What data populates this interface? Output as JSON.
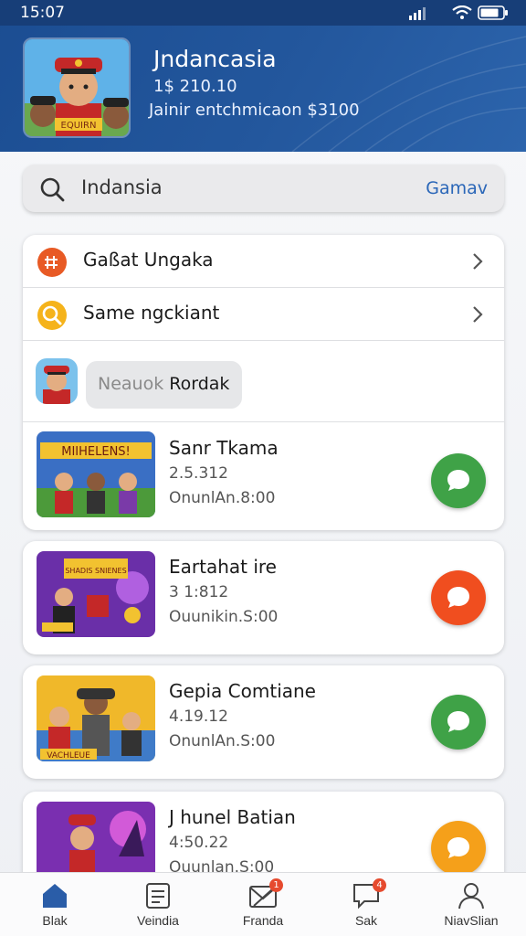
{
  "status_bar": {
    "time": "15:07"
  },
  "header": {
    "title": "Jndancasia",
    "subtitle_line1": "1$ 210.10",
    "subtitle_line2": "Jainir entchmicaon $3100"
  },
  "search": {
    "value": "Indansia",
    "action_label": "Gamav"
  },
  "menu": {
    "items": [
      {
        "label": "Gaßat Ungaka",
        "icon": "gift-icon",
        "color": "#e85a25"
      },
      {
        "label": "Same ngckiant",
        "icon": "search-icon",
        "color": "#f5b31b"
      }
    ],
    "chip": {
      "part1": "Neauok",
      "part2": "Rordak"
    }
  },
  "games": [
    {
      "title": "Sanr Tkama",
      "number": "2.5.312",
      "time": "OnunlAn.8:00",
      "thumb_text": "MIIHELENS!",
      "action_color": "#3fa247"
    },
    {
      "title": "Eartahat ire",
      "number": "3 1:812",
      "time": "Ouunikin.S:00",
      "thumb_text": "SHADIS SNIENES",
      "action_color": "#f04e1f"
    },
    {
      "title": "Gepia Comtiane",
      "number": "4.19.12",
      "time": "OnunlAn.S:00",
      "thumb_text": "VACHLEUE",
      "action_color": "#3fa247"
    },
    {
      "title": "J hunel Batian",
      "number": "4:50.22",
      "time": "Ouunlan.S:00",
      "thumb_text": "",
      "action_color": "#f5a01a"
    }
  ],
  "bottom_nav": [
    {
      "label": "Blak",
      "icon": "home-icon",
      "badge": ""
    },
    {
      "label": "Veindia",
      "icon": "document-icon",
      "badge": ""
    },
    {
      "label": "Franda",
      "icon": "mail-icon",
      "badge": "1"
    },
    {
      "label": "Sak",
      "icon": "chat-icon",
      "badge": "4"
    },
    {
      "label": "NiavSlian",
      "icon": "profile-icon",
      "badge": ""
    }
  ],
  "colors": {
    "header_blue": "#1f5298",
    "accent_blue": "#2b67b8",
    "green": "#3fa247",
    "orange_red": "#f04e1f",
    "amber": "#f5a01a"
  }
}
